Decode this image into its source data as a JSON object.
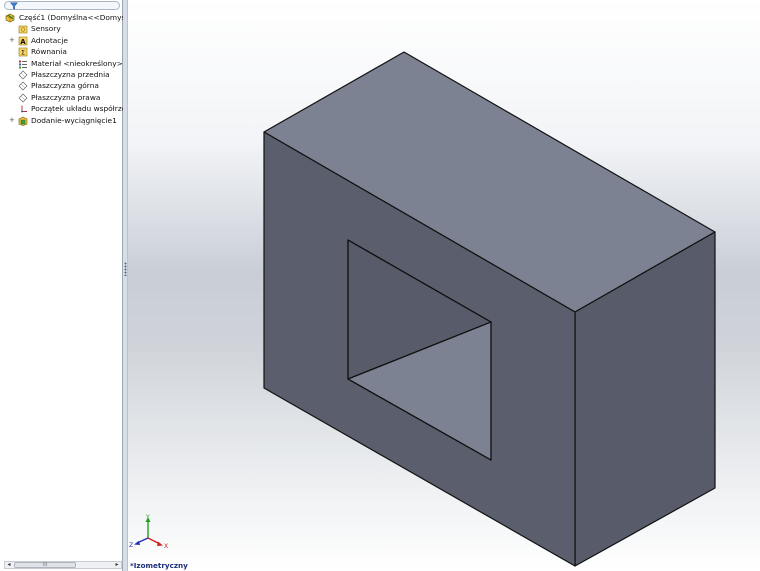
{
  "feature_tree": {
    "root": {
      "label": "Część1  (Domyślna<<Domyśln",
      "icon": "part-icon"
    },
    "items": [
      {
        "label": "Sensory",
        "icon": "sensors-folder-icon",
        "expandable": false
      },
      {
        "label": "Adnotacje",
        "icon": "annotations-icon",
        "expandable": true
      },
      {
        "label": "Równania",
        "icon": "equations-icon",
        "expandable": false
      },
      {
        "label": "Materiał <nieokreślony>",
        "icon": "material-icon",
        "expandable": false
      },
      {
        "label": "Płaszczyzna przednia",
        "icon": "plane-icon",
        "expandable": false
      },
      {
        "label": "Płaszczyzna górna",
        "icon": "plane-icon",
        "expandable": false
      },
      {
        "label": "Płaszczyzna prawa",
        "icon": "plane-icon",
        "expandable": false
      },
      {
        "label": "Początek układu współrzędn",
        "icon": "origin-icon",
        "expandable": false
      },
      {
        "label": "Dodanie-wyciągnięcie1",
        "icon": "extrude-feature-icon",
        "expandable": true
      }
    ]
  },
  "scrollbar": {
    "thumb_grip": "III",
    "left_arrow": "◂",
    "right_arrow": "▸"
  },
  "viewport": {
    "view_name": "*Izometryczny",
    "triad_axes": {
      "x": "X",
      "y": "Y",
      "z": "Z"
    },
    "colors": {
      "model_top": "#7d8292",
      "model_front": "#5b5f6d",
      "model_side": "#585c6a",
      "hole_inner_top": "#585c6a",
      "hole_inner_floor": "#7d8292",
      "edge": "#111111",
      "axis_x": "#d02020",
      "axis_y": "#20a020",
      "axis_z": "#2030c0"
    }
  }
}
